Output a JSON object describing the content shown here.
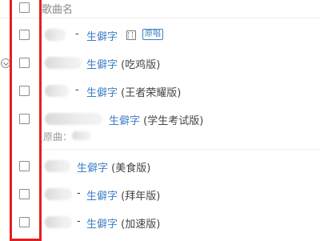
{
  "header": {
    "column_title": "歌曲名"
  },
  "rows": [
    {
      "dash": "-",
      "song": "生僻字",
      "version": "",
      "mv_icon": "mv-icon",
      "badge": "原唱"
    },
    {
      "dash": "",
      "song": "生僻字",
      "version": "(吃鸡版)"
    },
    {
      "dash": "-",
      "song": "生僻字",
      "version": "(王者荣耀版)"
    },
    {
      "dash": "",
      "song": "生僻字",
      "version": "(学生考试版)",
      "sub_label": "原曲："
    },
    {
      "dash": "",
      "song": "生僻字",
      "version": "(美食版)"
    },
    {
      "dash": "-",
      "song": "生僻字",
      "version": "(拜年版)"
    },
    {
      "dash": "-",
      "song": "生僻字",
      "version": "(加速版)"
    }
  ],
  "highlight_color": "#e02020",
  "link_color": "#3d7fc7"
}
